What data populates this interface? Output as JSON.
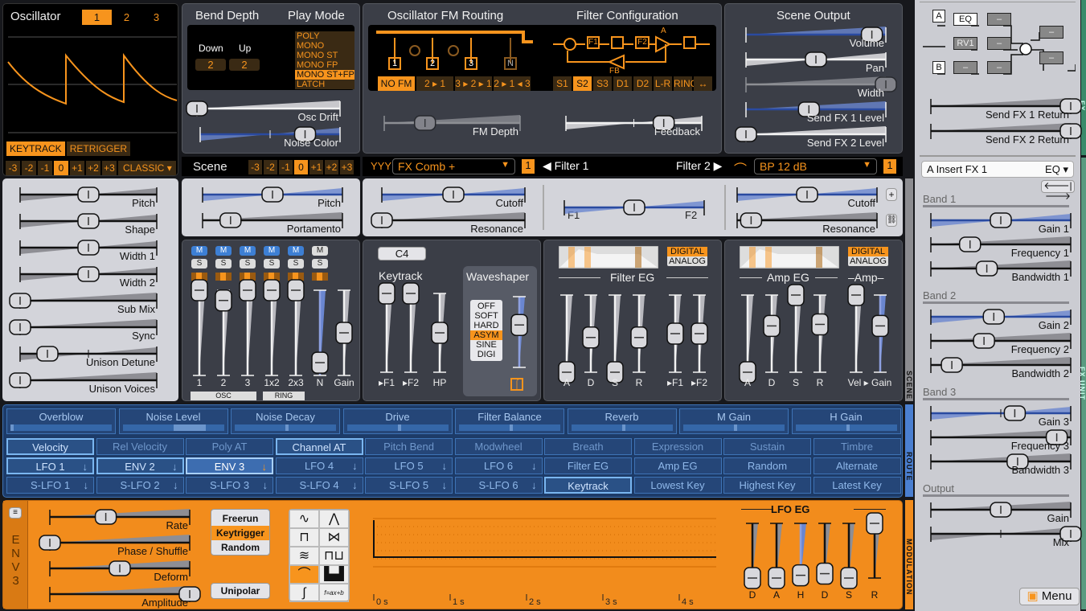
{
  "colors": {
    "accent": "#f7941d",
    "scene_panel": "#3b3e47",
    "route_bg": "#1d3b68",
    "modulation_bg": "#f28c1c",
    "fx_panel": "#cbccd2"
  },
  "oscillator": {
    "title": "Oscillator",
    "tabs": [
      "1",
      "2",
      "3"
    ],
    "active_tab": "1",
    "keytrack": "KEYTRACK",
    "retrigger": "RETRIGGER",
    "octave": [
      "-3",
      "-2",
      "-1",
      "0",
      "+1",
      "+2",
      "+3"
    ],
    "octave_active": "0",
    "type": "CLASSIC"
  },
  "osc_params": [
    {
      "label": "Pitch",
      "value": 0.5
    },
    {
      "label": "Shape",
      "value": 0.5
    },
    {
      "label": "Width 1",
      "value": 0.5
    },
    {
      "label": "Width 2",
      "value": 0.5
    },
    {
      "label": "Sub Mix",
      "value": 0.0
    },
    {
      "label": "Sync",
      "value": 0.0
    },
    {
      "label": "Unison Detune",
      "value": 0.2
    },
    {
      "label": "Unison Voices",
      "value": 0.0
    }
  ],
  "bend": {
    "title": "Bend Depth",
    "down_label": "Down",
    "up_label": "Up",
    "down": "2",
    "up": "2"
  },
  "play_mode": {
    "title": "Play Mode",
    "options": [
      "POLY",
      "MONO",
      "MONO ST",
      "MONO FP",
      "MONO ST+FP",
      "LATCH"
    ],
    "selected": "MONO ST+FP"
  },
  "global": {
    "osc_drift": {
      "label": "Osc Drift",
      "value": 0.0
    },
    "noise_color": {
      "label": "Noise Color",
      "value": 0.75
    }
  },
  "fm_routing": {
    "title": "Oscillator FM Routing",
    "boxes": [
      "1",
      "2",
      "3",
      "N"
    ],
    "modes": [
      "NO FM",
      "2 ▸ 1",
      "3 ▸ 2 ▸ 1",
      "2 ▸ 1 ◂ 3"
    ],
    "selected": "NO FM",
    "depth": {
      "label": "FM Depth",
      "value": 0.3
    }
  },
  "filter_config": {
    "title": "Filter Configuration",
    "blocks": [
      "F1",
      "F2"
    ],
    "amp_label": "A",
    "fb_label": "FB",
    "modes": [
      "S1",
      "S2",
      "S3",
      "D1",
      "D2",
      "L-R",
      "RING",
      "↔"
    ],
    "selected": "S2",
    "feedback": {
      "label": "Feedback",
      "value": 0.72
    }
  },
  "scene_output": {
    "title": "Scene Output",
    "sliders": [
      {
        "label": "Volume",
        "value": 0.9
      },
      {
        "label": "Pan",
        "value": 0.5
      },
      {
        "label": "Width",
        "value": 1.0
      },
      {
        "label": "Send FX 1 Level",
        "value": 0.45
      },
      {
        "label": "Send FX 2 Level",
        "value": 0.0
      }
    ]
  },
  "scene": {
    "title": "Scene",
    "octave": [
      "-3",
      "-2",
      "-1",
      "0",
      "+1",
      "+2",
      "+3"
    ],
    "octave_active": "0",
    "pitch": {
      "label": "Pitch",
      "value": 0.5
    },
    "portamento": {
      "label": "Portamento",
      "value": 0.2
    }
  },
  "filters": {
    "filter1_type": "FX Comb +",
    "filter1_sub": "1",
    "filter1_label": "Filter 1",
    "filter2_label": "Filter 2",
    "filter2_type": "BP 12 dB",
    "filter2_sub": "1",
    "cutoff1": {
      "label": "Cutoff",
      "value": 0.5
    },
    "resonance1": {
      "label": "Resonance",
      "value": 0.0
    },
    "balance": {
      "label": "",
      "value": 0.5,
      "left": "F1",
      "right": "F2"
    },
    "cutoff2": {
      "label": "Cutoff",
      "value": 0.5
    },
    "resonance2": {
      "label": "Resonance",
      "value": 0.1
    }
  },
  "mixer": {
    "mute": "M",
    "solo": "S",
    "channels": [
      {
        "label": "1",
        "value": 1.0,
        "mute_on": true
      },
      {
        "label": "2",
        "value": 0.88,
        "mute_on": true
      },
      {
        "label": "3",
        "value": 1.0,
        "mute_on": true
      },
      {
        "label": "1x2",
        "value": 1.0,
        "mute_on": true
      },
      {
        "label": "2x3",
        "value": 1.0,
        "mute_on": true
      },
      {
        "label": "N",
        "value": 0.15,
        "mute_on": false
      },
      {
        "label": "Gain",
        "value": 0.5,
        "mute_on": false
      }
    ],
    "osc_group": "OSC",
    "ring_group": "RING"
  },
  "keytrack": {
    "note": "C4",
    "title": "Keytrack",
    "sliders": [
      {
        "label": "▸F1",
        "value": 1.0
      },
      {
        "label": "▸F2",
        "value": 1.0
      },
      {
        "label": "HP",
        "value": 0.5
      }
    ]
  },
  "waveshaper": {
    "title": "Waveshaper",
    "options": [
      "OFF",
      "SOFT",
      "HARD",
      "ASYM",
      "SINE",
      "DIGI"
    ],
    "selected": "ASYM",
    "drive": {
      "label": "",
      "value": 0.6
    }
  },
  "filter_eg": {
    "title": "Filter EG",
    "modes": [
      "DIGITAL",
      "ANALOG"
    ],
    "selected": "DIGITAL",
    "sliders": [
      {
        "label": "A",
        "value": 0.0
      },
      {
        "label": "D",
        "value": 0.45
      },
      {
        "label": "S",
        "value": 0.0
      },
      {
        "label": "R",
        "value": 0.45
      },
      {
        "label": "▸F1",
        "value": 0.5
      },
      {
        "label": "▸F2",
        "value": 0.5
      }
    ]
  },
  "amp_eg": {
    "title": "Amp EG",
    "amp_title": "Amp",
    "modes": [
      "DIGITAL",
      "ANALOG"
    ],
    "selected": "DIGITAL",
    "sliders": [
      {
        "label": "A",
        "value": 0.0
      },
      {
        "label": "D",
        "value": 0.6
      },
      {
        "label": "S",
        "value": 1.0
      },
      {
        "label": "R",
        "value": 0.62
      },
      {
        "label": "Vel ▸ Gain",
        "value": 1.0
      },
      {
        "label": "",
        "value": 0.6
      }
    ]
  },
  "routing": {
    "macros": [
      {
        "label": "Overblow",
        "value": 0.0
      },
      {
        "label": "Noise Level",
        "value": 0.5
      },
      {
        "label": "Noise Decay",
        "value": 0.5
      },
      {
        "label": "Drive",
        "value": 0.5
      },
      {
        "label": "Filter Balance",
        "value": 0.5
      },
      {
        "label": "Reverb",
        "value": 0.5
      },
      {
        "label": "M Gain",
        "value": 0.5
      },
      {
        "label": "H Gain",
        "value": 0.5
      }
    ],
    "row2": [
      "Velocity",
      "Rel Velocity",
      "Poly AT",
      "Channel AT",
      "Pitch Bend",
      "Modwheel",
      "Breath",
      "Expression",
      "Sustain",
      "Timbre"
    ],
    "row3": [
      "LFO 1",
      "ENV 2",
      "ENV 3",
      "LFO 4",
      "LFO 5",
      "LFO 6",
      "Filter EG",
      "Amp EG",
      "Random",
      "Alternate"
    ],
    "row4": [
      "S-LFO 1",
      "S-LFO 2",
      "S-LFO 3",
      "S-LFO 4",
      "S-LFO 5",
      "S-LFO 6",
      "Keytrack",
      "Lowest Key",
      "Highest Key",
      "Latest Key"
    ],
    "selected": "ENV 3",
    "highlighted": [
      "Velocity",
      "Channel AT",
      "LFO 1",
      "ENV 2",
      "Keytrack"
    ],
    "with_arrow": [
      "LFO 1",
      "ENV 2",
      "ENV 3",
      "LFO 4",
      "LFO 5",
      "LFO 6",
      "S-LFO 1",
      "S-LFO 2",
      "S-LFO 3",
      "S-LFO 4",
      "S-LFO 5",
      "S-LFO 6"
    ]
  },
  "modulation": {
    "tab_letters": [
      "E",
      "N",
      "V",
      "3"
    ],
    "sliders": [
      {
        "label": "Rate",
        "value": 0.4
      },
      {
        "label": "Phase / Shuffle",
        "value": 0.0
      },
      {
        "label": "Deform",
        "value": 0.5
      },
      {
        "label": "Amplitude",
        "value": 1.0
      }
    ],
    "triggers": [
      "Freerun",
      "Keytrigger",
      "Random"
    ],
    "trigger_selected": "Keytrigger",
    "unipolar": "Unipolar",
    "shapes": [
      "sine",
      "triangle",
      "square",
      "saw",
      "noise",
      "sample-hold",
      "envelope",
      "stepseq",
      "function",
      "formula"
    ],
    "shape_selected": "envelope",
    "formula_label": "f=ax+b",
    "time_labels": [
      "0 s",
      "1 s",
      "2 s",
      "3 s",
      "4 s"
    ],
    "eg_title": "LFO EG",
    "eg_sliders": [
      {
        "label": "D",
        "value": 0.0
      },
      {
        "label": "A",
        "value": 0.0
      },
      {
        "label": "H",
        "value": 0.05
      },
      {
        "label": "D",
        "value": 0.08
      },
      {
        "label": "S",
        "value": 0.0
      },
      {
        "label": "R",
        "value": 1.0
      }
    ]
  },
  "fx": {
    "chain": {
      "a": "A",
      "b": "B",
      "eq": "EQ",
      "rv1": "RV1",
      "empty": "–"
    },
    "sends": [
      {
        "label": "Send FX 1 Return",
        "value": 1.0
      },
      {
        "label": "Send FX 2 Return",
        "value": 1.0
      }
    ],
    "slot": "A Insert FX 1",
    "type": "EQ",
    "bands": [
      {
        "title": "Band 1",
        "sliders": [
          {
            "label": "Gain 1",
            "value": 0.5
          },
          {
            "label": "Frequency 1",
            "value": 0.28
          },
          {
            "label": "Bandwidth 1",
            "value": 0.4
          }
        ]
      },
      {
        "title": "Band 2",
        "sliders": [
          {
            "label": "Gain 2",
            "value": 0.45
          },
          {
            "label": "Frequency 2",
            "value": 0.38
          },
          {
            "label": "Bandwidth 2",
            "value": 0.15
          }
        ]
      },
      {
        "title": "Band 3",
        "sliders": [
          {
            "label": "Gain 3",
            "value": 0.6
          },
          {
            "label": "Frequency 3",
            "value": 0.9
          },
          {
            "label": "Bandwidth 3",
            "value": 0.62
          }
        ]
      }
    ],
    "output": {
      "title": "Output",
      "sliders": [
        {
          "label": "Gain",
          "value": 0.5
        },
        {
          "label": "Mix",
          "value": 1.0
        }
      ]
    }
  },
  "side_tabs": {
    "scene": "SCENE",
    "route": "ROUTE",
    "modulation": "MODULATION",
    "fx": "FX",
    "fx_unit": "FX UNIT"
  },
  "menu_label": "Menu"
}
